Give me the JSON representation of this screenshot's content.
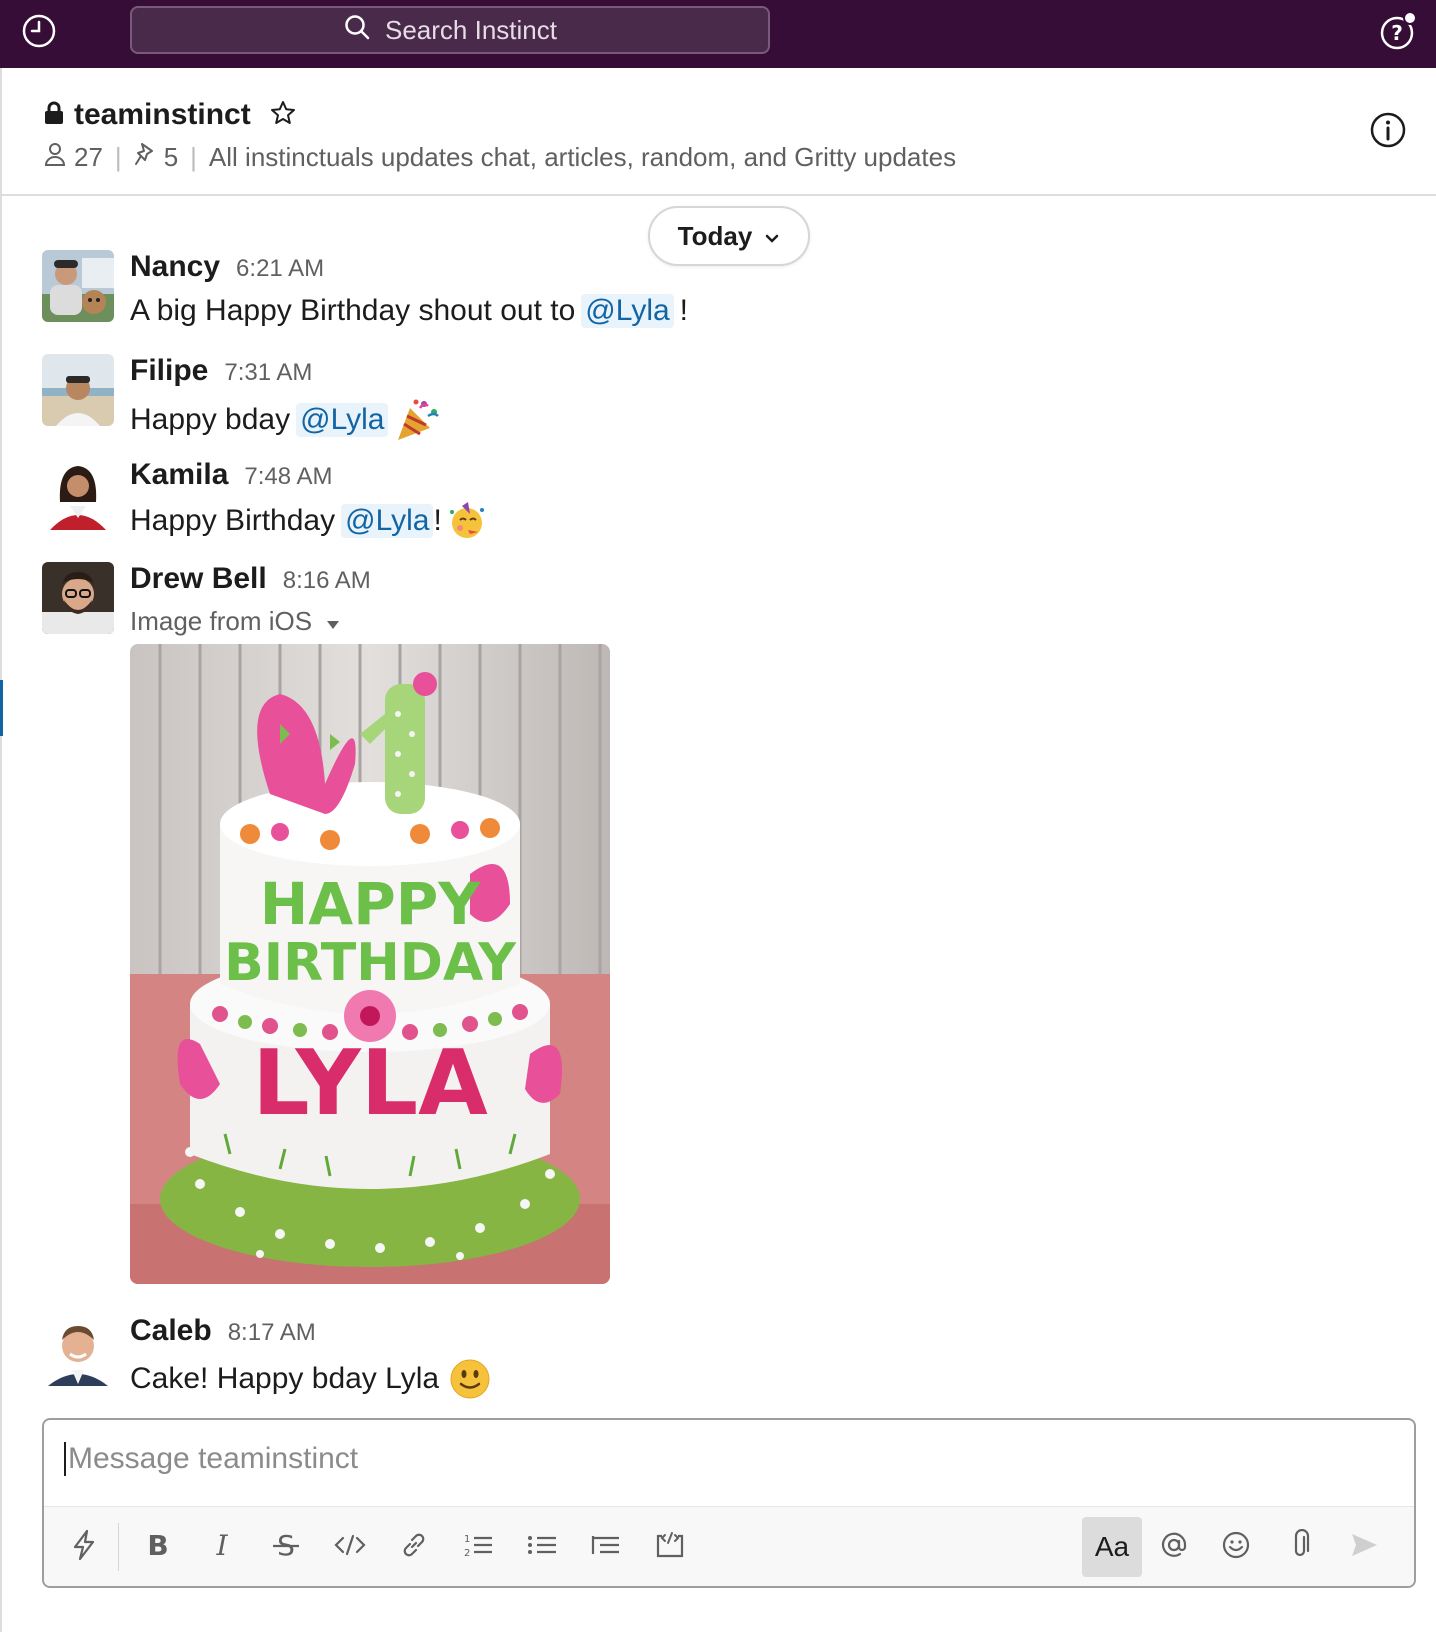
{
  "topbar": {
    "search_placeholder": "Search Instinct",
    "history_icon": "clock-icon",
    "help_icon": "help-icon",
    "bg_color": "#350d36"
  },
  "channel": {
    "name": "teaminstinct",
    "member_count": "27",
    "pinned_count": "5",
    "topic": "All instinctuals updates chat, articles, random, and Gritty updates"
  },
  "divider": {
    "label": "Today"
  },
  "messages": [
    {
      "author": "Nancy",
      "time": "6:21 AM",
      "text_before": "A big Happy Birthday shout out to",
      "mention": "@Lyla",
      "text_after": "!"
    },
    {
      "author": "Filipe",
      "time": "7:31 AM",
      "text_before": "Happy bday",
      "mention": "@Lyla",
      "emoji": "party-popper"
    },
    {
      "author": "Kamila",
      "time": "7:48 AM",
      "text_before": "Happy Birthday",
      "mention": "@Lyla",
      "text_after": "!",
      "emoji": "partying-face"
    },
    {
      "author": "Drew Bell",
      "time": "8:16 AM",
      "file_label": "Image from iOS",
      "image_text": {
        "line1": "HAPPY",
        "line2": "BIRTHDAY",
        "line3": "LYLA"
      }
    },
    {
      "author": "Caleb",
      "time": "8:17 AM",
      "text_before": "Cake! Happy bday Lyla",
      "emoji": "slightly-smiling-face"
    }
  ],
  "composer": {
    "placeholder": "Message teaminstinct",
    "aa_label": "Aa"
  },
  "colors": {
    "mention_bg": "#e8f3fb",
    "mention_text": "#1264a3",
    "link_blue": "#1264a3"
  }
}
